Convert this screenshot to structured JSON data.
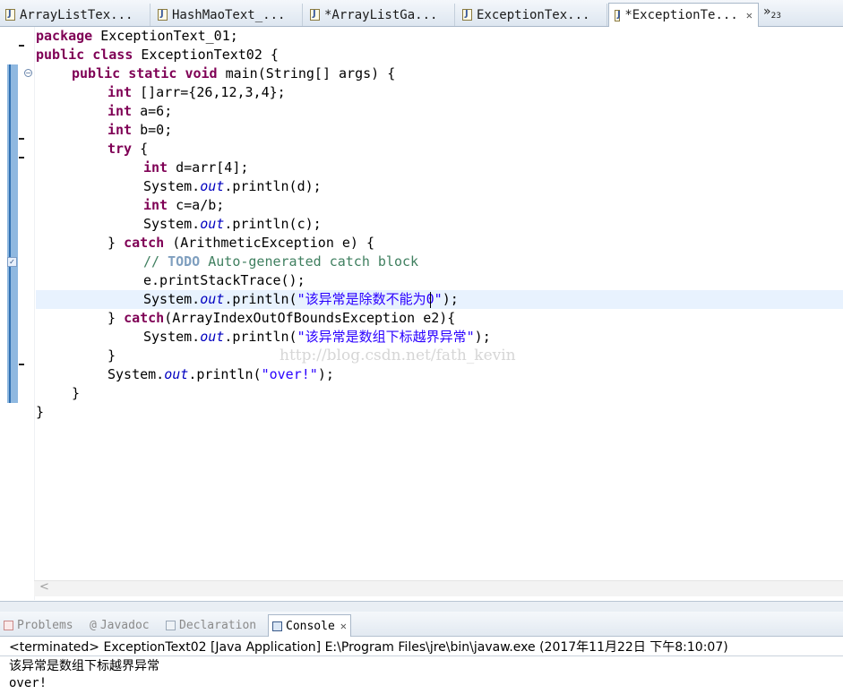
{
  "editor_tabs": [
    {
      "label": "ArrayListTex...",
      "active": false
    },
    {
      "label": "HashMaoText_...",
      "active": false
    },
    {
      "label": "*ArrayListGa...",
      "active": false
    },
    {
      "label": "ExceptionTex...",
      "active": false
    },
    {
      "label": "*ExceptionTe...",
      "active": true
    }
  ],
  "overflow": {
    "chevron": "»",
    "count": "23"
  },
  "code": {
    "l1a": "package",
    "l1b": " ExceptionText_01;",
    "l2a": "public",
    "l2b": "class",
    "l2c": " ExceptionText02 {",
    "l3a": "public",
    "l3b": "static",
    "l3c": "void",
    "l3d": " main(String[] args) {",
    "l4a": "int",
    "l4b": " []arr={26,12,3,4};",
    "l5a": "int",
    "l5b": " a=6;",
    "l6a": "int",
    "l6b": " b=0;",
    "l7a": "try",
    "l7b": " {",
    "l8a": "int",
    "l8b": " d=arr[4];",
    "l9a": "System.",
    "l9b": "out",
    "l9c": ".println(d);",
    "l10a": "int",
    "l10b": " c=a/b;",
    "l11a": "System.",
    "l11b": "out",
    "l11c": ".println(c);",
    "l12a": "} ",
    "l12b": "catch",
    "l12c": " (ArithmeticException e) {",
    "l13a": "// ",
    "l13b": "TODO",
    "l13c": " Auto-generated catch block",
    "l14a": "e.printStackTrace();",
    "l15a": "System.",
    "l15b": "out",
    "l15c": ".println(",
    "l15d": "\"该异常是除数不能为0\"",
    "l15e": ");",
    "l16a": "} ",
    "l16b": "catch",
    "l16c": "(ArrayIndexOutOfBoundsException e2){",
    "l17a": "System.",
    "l17b": "out",
    "l17c": ".println(",
    "l17d": "\"该异常是数组下标越界异常\"",
    "l17e": ");",
    "l18a": "}",
    "l19a": "System.",
    "l19b": "out",
    "l19c": ".println(",
    "l19d": "\"over!\"",
    "l19e": ");",
    "l20a": "}",
    "l21a": "}"
  },
  "watermark": "http://blog.csdn.net/fath_kevin",
  "views": [
    {
      "label": "Problems",
      "icon": "problems-icon",
      "active": false
    },
    {
      "label": "Javadoc",
      "icon": "javadoc-icon",
      "active": false
    },
    {
      "label": "Declaration",
      "icon": "declaration-icon",
      "active": false
    },
    {
      "label": "Console",
      "icon": "console-icon",
      "active": true
    }
  ],
  "console": {
    "status": "<terminated> ExceptionText02 [Java Application] E:\\Program Files\\jre\\bin\\javaw.exe (2017年11月22日 下午8:10:07)",
    "output_1": "该异常是数组下标越界异常",
    "output_2": "over!"
  },
  "colors": {
    "keyword": "#7f0055",
    "string": "#2a00ff",
    "field": "#0000c0",
    "comment": "#3f7f5f",
    "todo": "#7f9fbf",
    "current_line": "#e8f2fe"
  }
}
